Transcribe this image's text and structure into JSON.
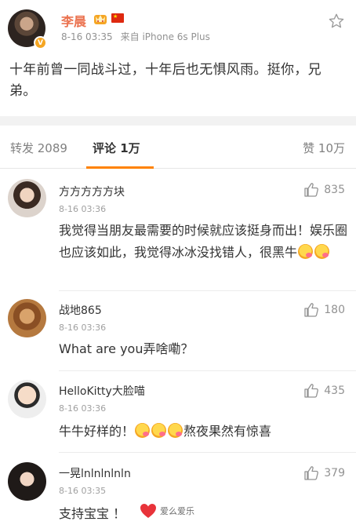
{
  "post": {
    "author": "李晨",
    "verified_badge": "V",
    "flag_glyph": "★",
    "time": "8-16 03:35",
    "source": "来自 iPhone 6s Plus",
    "content": "十年前曾一同战斗过，十年后也无惧风雨。挺你，兄弟。",
    "icons": {
      "crown": "crown-icon",
      "flag": "china-flag-icon",
      "favorite": "star-icon"
    }
  },
  "tabs": {
    "repost": "转发 2089",
    "comments": "评论 1万",
    "likes": "赞 10万"
  },
  "comments": [
    {
      "name": "方方方方方块",
      "time": "8-16 03:36",
      "text": "我觉得当朋友最需要的时候就应该挺身而出！娱乐圈也应该如此，我觉得冰冰没找错人，很黑牛",
      "likes": "835"
    },
    {
      "name": "战地865",
      "time": "8-16 03:36",
      "text": "What are you弄啥嘞？",
      "likes": "180"
    },
    {
      "name": "HelloKitty大脸喵",
      "time": "8-16 03:36",
      "text_before": "牛牛好样的！",
      "text_after": "熬夜果然有惊喜",
      "likes": "435"
    },
    {
      "name": "一晃lnlnlnlnln",
      "time": "8-16 03:35",
      "text": "支持宝宝 ！",
      "likes": "379"
    }
  ],
  "watermark": {
    "text": "爱么爱乐"
  },
  "colors": {
    "accent": "#ff8200",
    "author": "#eb7350",
    "muted": "#929292",
    "background_gap": "#f2f2f2"
  }
}
